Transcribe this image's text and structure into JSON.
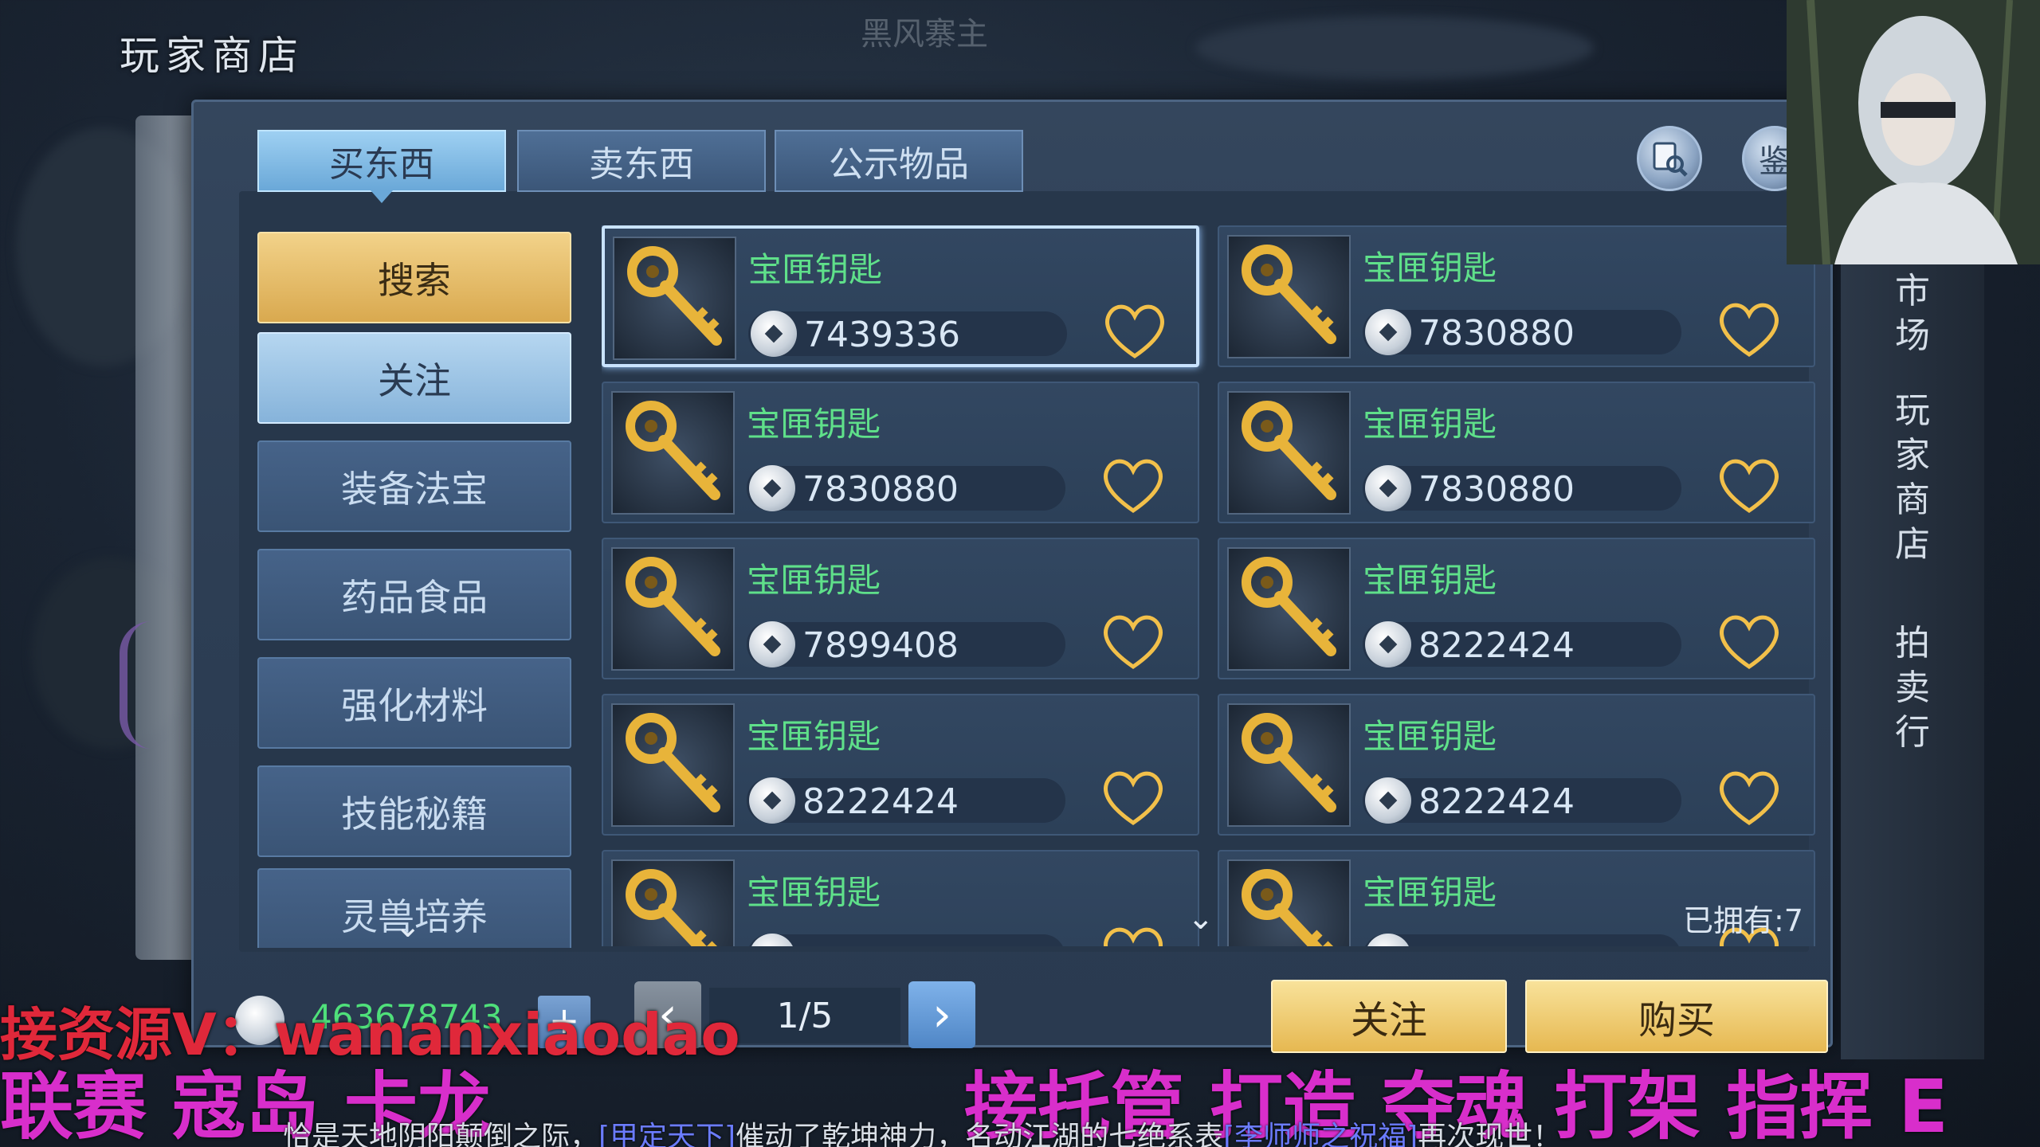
{
  "title": "玩家商店",
  "top_faint_text": "黑风寨主",
  "tabs": [
    {
      "label": "买东西",
      "active": true
    },
    {
      "label": "卖东西",
      "active": false
    },
    {
      "label": "公示物品",
      "active": false
    }
  ],
  "top_buttons": {
    "search_icon": "magnifier-scroll-icon",
    "appraise_label": "鉴"
  },
  "categories": [
    {
      "label": "搜索",
      "state": "selected"
    },
    {
      "label": "关注",
      "state": "highlight"
    },
    {
      "label": "装备法宝",
      "state": "normal"
    },
    {
      "label": "药品食品",
      "state": "normal"
    },
    {
      "label": "强化材料",
      "state": "normal"
    },
    {
      "label": "技能秘籍",
      "state": "normal"
    },
    {
      "label": "灵兽培养",
      "state": "normal"
    }
  ],
  "items": [
    {
      "name": "宝匣钥匙",
      "price": "7439336",
      "selected": true
    },
    {
      "name": "宝匣钥匙",
      "price": "7830880",
      "selected": false
    },
    {
      "name": "宝匣钥匙",
      "price": "7830880",
      "selected": false
    },
    {
      "name": "宝匣钥匙",
      "price": "7830880",
      "selected": false
    },
    {
      "name": "宝匣钥匙",
      "price": "7899408",
      "selected": false
    },
    {
      "name": "宝匣钥匙",
      "price": "8222424",
      "selected": false
    },
    {
      "name": "宝匣钥匙",
      "price": "8222424",
      "selected": false
    },
    {
      "name": "宝匣钥匙",
      "price": "8222424",
      "selected": false
    },
    {
      "name": "宝匣钥匙",
      "price": "",
      "selected": false
    },
    {
      "name": "宝匣钥匙",
      "price": "",
      "selected": false
    }
  ],
  "owned_label": "已拥有:7",
  "side_nav": [
    {
      "label": "市场"
    },
    {
      "label": "玩家商店"
    },
    {
      "label": "拍卖行"
    }
  ],
  "currency_value": "463678743",
  "pagination": {
    "current": "1/5"
  },
  "actions": {
    "follow_label": "关注",
    "buy_label": "购买"
  },
  "watermarks": {
    "contact": "接资源V：wananxiaodao",
    "left_banner": "联赛 寇岛 卡龙",
    "right_banner": "接托管 打造 夺魂 打架 指挥 E"
  },
  "chat": {
    "prefix": "恰是天地阴阳颠倒之际，",
    "tag1": "[甲定天下]",
    "middle": "催动了乾坤神力，名动江湖的七绝系表",
    "tag2": "[李师师之祝福]",
    "suffix": "再次现世！"
  },
  "colors": {
    "item_name": "#5fe08a",
    "gold_button": "#e6b851",
    "active_tab": "#6aa8d8",
    "heart_outline": "#f2c04a",
    "watermark_red": "#e0283a",
    "watermark_magenta": "#d82ecb"
  }
}
